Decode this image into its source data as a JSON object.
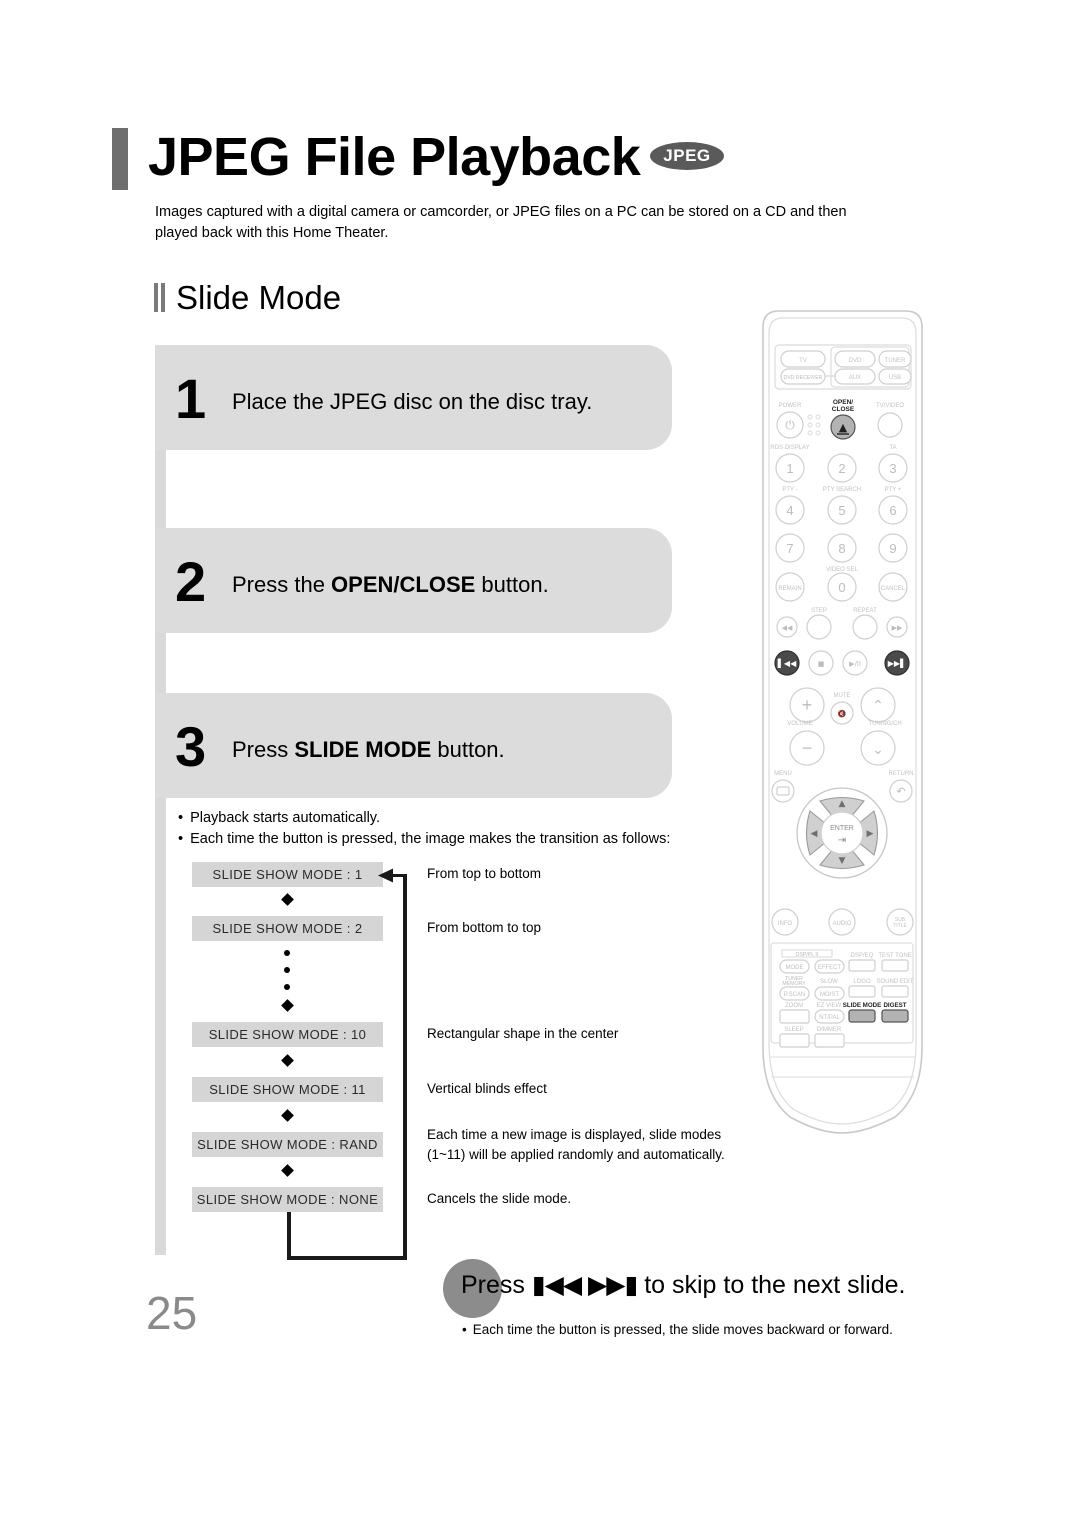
{
  "header": {
    "title": "JPEG File Playback",
    "badge": "JPEG",
    "intro": "Images captured with a digital camera or camcorder, or JPEG files on a PC can be stored on a CD and then played back with this Home Theater."
  },
  "section": {
    "heading": "Slide Mode"
  },
  "steps": [
    {
      "number": "1",
      "text_prefix": "Place the JPEG disc on the disc tray.",
      "bold": "",
      "text_suffix": ""
    },
    {
      "number": "2",
      "text_prefix": "Press the ",
      "bold": "OPEN/CLOSE",
      "text_suffix": " button."
    },
    {
      "number": "3",
      "text_prefix": "Press ",
      "bold": "SLIDE MODE",
      "text_suffix": " button."
    }
  ],
  "bullets": [
    "Playback starts automatically.",
    "Each time the button is pressed, the image makes the transition as follows:"
  ],
  "flow": {
    "chips": [
      {
        "label": "SLIDE SHOW MODE : 1",
        "note": "From top to bottom"
      },
      {
        "label": "SLIDE SHOW MODE : 2",
        "note": "From bottom to top"
      },
      {
        "label": "SLIDE SHOW MODE : 10",
        "note": "Rectangular shape in the center"
      },
      {
        "label": "SLIDE SHOW MODE : 11",
        "note": "Vertical blinds effect"
      },
      {
        "label": "SLIDE SHOW MODE : RAND",
        "note": "Each time a new image is displayed, slide modes (1~11) will be applied randomly and automatically."
      },
      {
        "label": "SLIDE SHOW MODE : NONE",
        "note": "Cancels the slide mode."
      }
    ]
  },
  "skip": {
    "press": "Press",
    "glyph_back": "▮◀◀",
    "glyph_fwd": "▶▶▮",
    "tail": "to skip to the next slide.",
    "note": "Each time the button is pressed, the slide moves backward or forward."
  },
  "page_number": "25",
  "remote": {
    "source_buttons": [
      "TV",
      "DVD",
      "TUNER",
      "DVD RECEIVER",
      "AUX",
      "USB"
    ],
    "power_label": "POWER",
    "open_close_label": "OPEN/\nCLOSE",
    "tv_video_label": "TV/VIDEO",
    "rds_display_label": "RDS DISPLAY",
    "ta_label": "TA",
    "numeric_keys": [
      "1",
      "2",
      "3",
      "4",
      "5",
      "6",
      "7",
      "8",
      "9",
      "0"
    ],
    "pty_minus": "PTY -",
    "pty_search": "PTY SEARCH",
    "pty_plus": "PTY +",
    "video_sel": "VIDEO SEL",
    "remain": "REMAIN",
    "cancel": "CANCEL",
    "step": "STEP",
    "repeat": "REPEAT",
    "volume": "VOLUME",
    "mute": "MUTE",
    "tuning_ch": "TUNING/CH",
    "menu": "MENU",
    "return": "RETURN",
    "enter": "ENTER",
    "info": "INFO",
    "audio": "AUDIO",
    "subtitle": "SUB TITLE",
    "dsp_pro_logic": "DSP/PL II",
    "grid_labels": [
      "MODE",
      "EFFECT",
      "DSP/EQ",
      "TEST TONE",
      "TUNER MEMORY",
      "SLOW",
      "LOGO",
      "SOUND EDIT",
      "P.SCAN",
      "MO/ST",
      "ZOOM",
      "EZ VIEW",
      "SLIDE MODE",
      "DIGEST",
      "NT/PAL",
      "SLEEP",
      "DIMMER"
    ],
    "highlighted": [
      "OPEN/CLOSE",
      "skip-back",
      "skip-forward",
      "SLIDE MODE",
      "DIGEST"
    ]
  },
  "colors": {
    "step_box": "#dcdcdc",
    "chip": "#d5d5d5",
    "accent_gray": "#6e6e6e",
    "highlight": "#b3b3b3"
  }
}
